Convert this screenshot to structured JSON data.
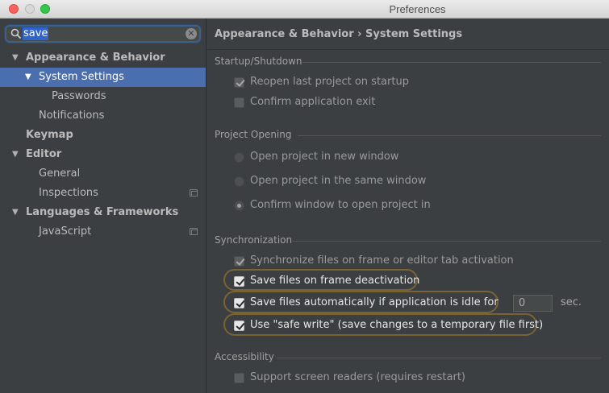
{
  "window": {
    "title": "Preferences"
  },
  "search": {
    "query": "save"
  },
  "sidebar": {
    "items": [
      {
        "label": "Appearance & Behavior",
        "level": 0,
        "bold": true,
        "expanded": true
      },
      {
        "label": "System Settings",
        "level": 1,
        "selected": true,
        "expanded": true
      },
      {
        "label": "Passwords",
        "level": 2
      },
      {
        "label": "Notifications",
        "level": 1
      },
      {
        "label": "Keymap",
        "level": 0,
        "bold": true
      },
      {
        "label": "Editor",
        "level": 0,
        "bold": true,
        "expanded": true
      },
      {
        "label": "General",
        "level": 1
      },
      {
        "label": "Inspections",
        "level": 1,
        "project_icon": true
      },
      {
        "label": "Languages & Frameworks",
        "level": 0,
        "bold": true,
        "expanded": true
      },
      {
        "label": "JavaScript",
        "level": 1,
        "project_icon": true
      }
    ]
  },
  "breadcrumb": "Appearance & Behavior › System Settings",
  "groups": {
    "startup": {
      "title": "Startup/Shutdown",
      "reopen": {
        "label": "Reopen last project on startup",
        "checked": true
      },
      "confirm_exit": {
        "label": "Confirm application exit",
        "checked": false
      }
    },
    "project_opening": {
      "title": "Project Opening",
      "new_window": {
        "label": "Open project in new window",
        "selected": false
      },
      "same_window": {
        "label": "Open project in the same window",
        "selected": false
      },
      "confirm_window": {
        "label": "Confirm window to open project in",
        "selected": true
      }
    },
    "sync": {
      "title": "Synchronization",
      "sync_files": {
        "label": "Synchronize files on frame or editor tab activation",
        "checked": true
      },
      "save_deactivation": {
        "label": "Save files on frame deactivation",
        "checked": true
      },
      "save_idle": {
        "label": "Save files automatically if application is idle for",
        "checked": true
      },
      "idle_value": "0",
      "idle_unit": "sec.",
      "safe_write": {
        "label": "Use \"safe write\" (save changes to a temporary file first)",
        "checked": true
      }
    },
    "accessibility": {
      "title": "Accessibility",
      "screen_readers": {
        "label": "Support screen readers (requires restart)",
        "checked": false
      }
    }
  },
  "colors": {
    "selection": "#4b6eaf",
    "search_highlight": "#2f65ca",
    "match_outline": "#7a6330"
  }
}
